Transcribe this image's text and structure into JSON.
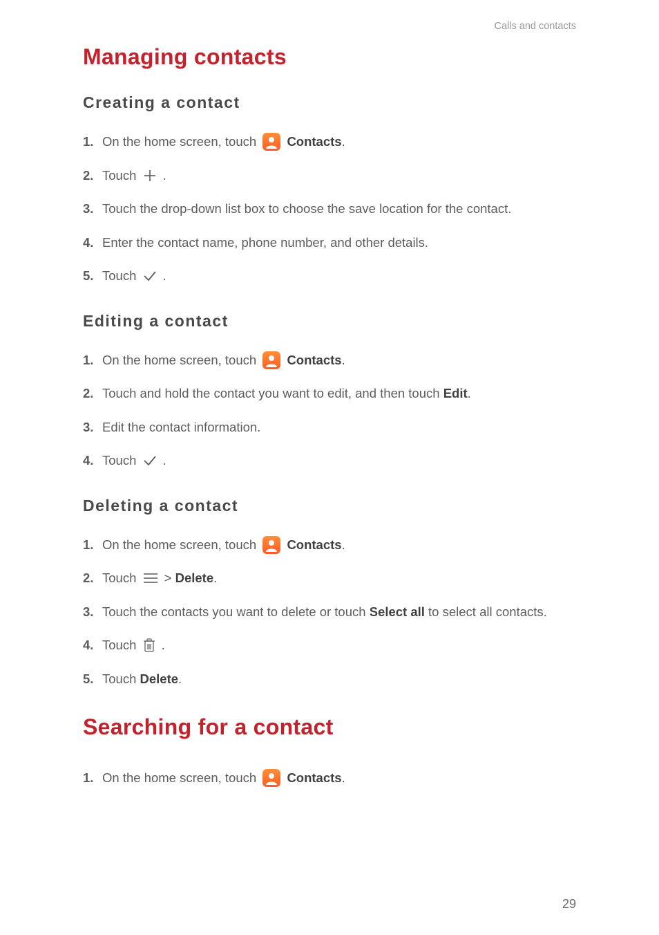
{
  "runningHead": "Calls and contacts",
  "pageNumber": "29",
  "headings": {
    "managing": "Managing contacts",
    "creating": "Creating  a  contact",
    "editing": "Editing  a  contact",
    "deleting": "Deleting  a  contact",
    "searching": "Searching for a contact"
  },
  "labels": {
    "contacts": "Contacts",
    "edit": "Edit",
    "delete": "Delete",
    "selectAll": "Select all"
  },
  "text": {
    "onHomeTouch": "On the home screen, touch ",
    "touch": "Touch ",
    "period": ".",
    "gt": " > ",
    "createStep3": "Touch the drop-down list box to choose the save location for the contact.",
    "createStep4": "Enter the contact name, phone number, and other details.",
    "editStep2a": "Touch and hold the contact you want to edit, and then touch ",
    "editStep3": "Edit the contact information.",
    "deleteStep3a": "Touch the contacts you want to delete or touch ",
    "deleteStep3b": " to select all contacts."
  }
}
